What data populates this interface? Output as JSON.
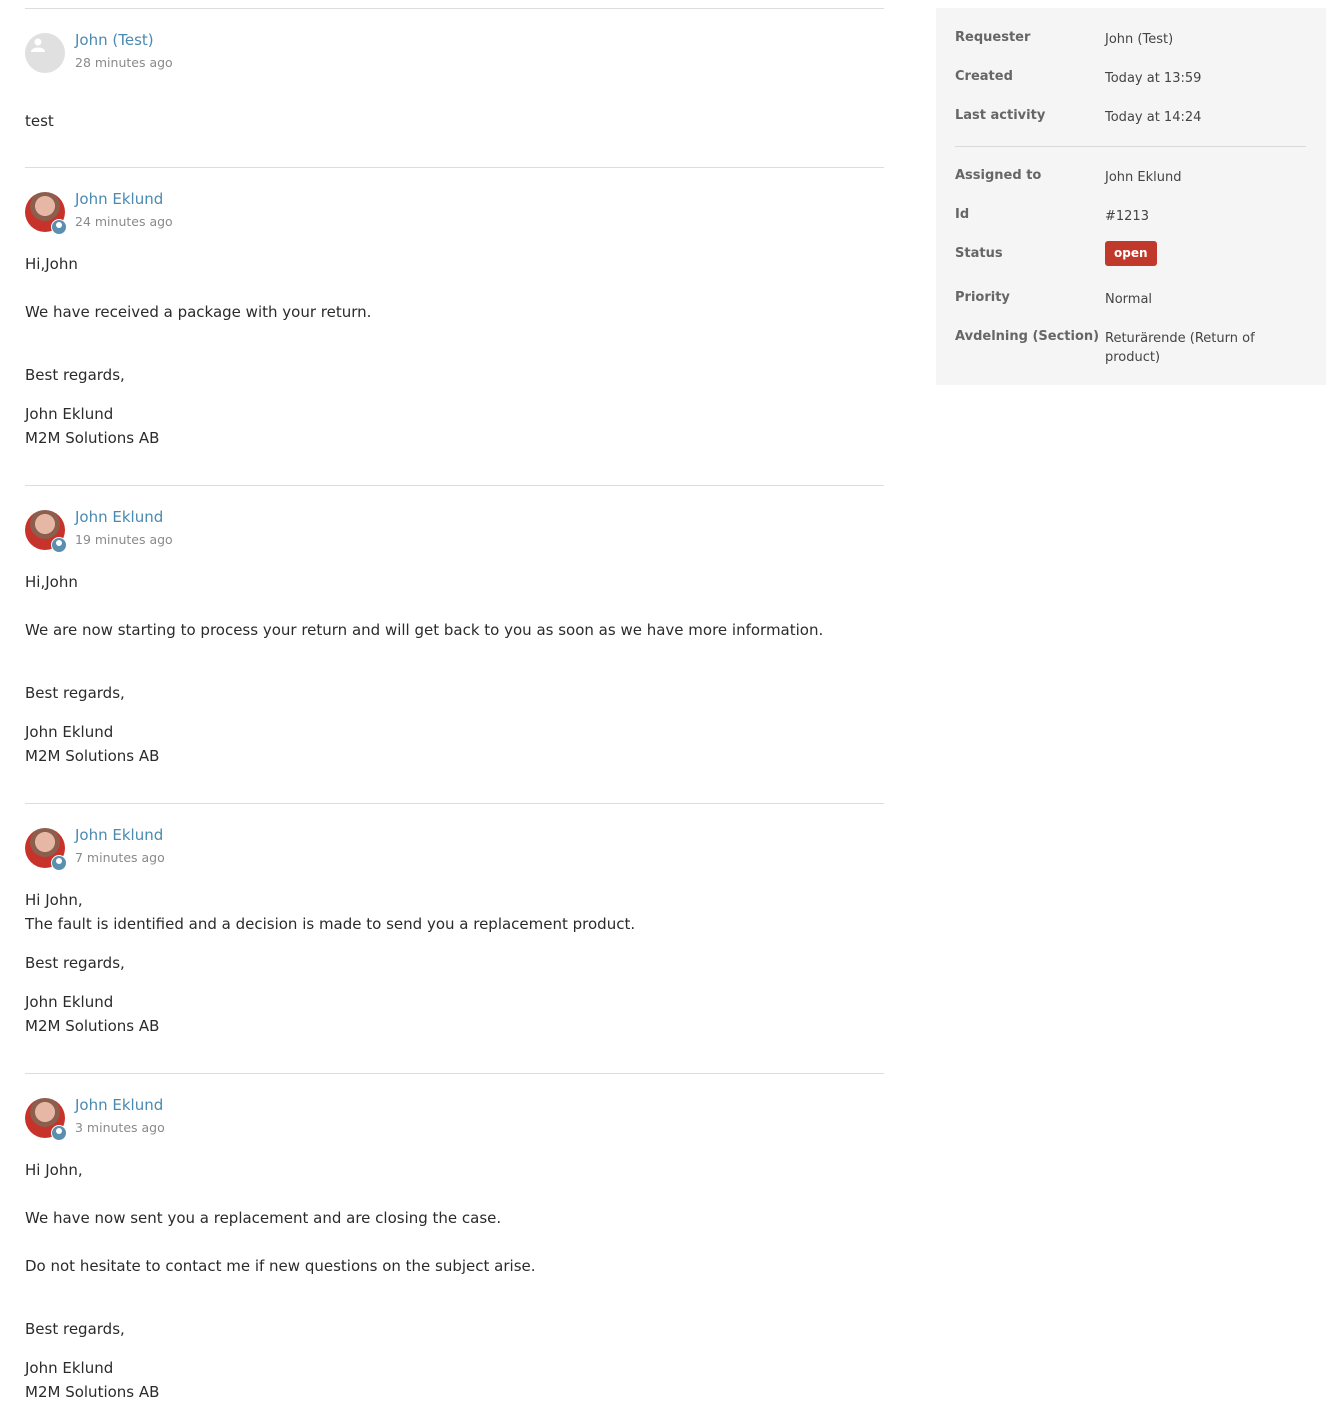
{
  "comments": [
    {
      "author": "John (Test)",
      "time": "28 minutes ago",
      "is_agent": false,
      "lines": [
        "test"
      ]
    },
    {
      "author": "John Eklund",
      "time": "24 minutes ago",
      "is_agent": true,
      "lines": [
        "Hi,John",
        "We have received a package with your return.",
        "Best regards,",
        "John Eklund",
        "M2M Solutions AB"
      ]
    },
    {
      "author": "John Eklund",
      "time": "19 minutes ago",
      "is_agent": true,
      "lines": [
        "Hi,John",
        "We are now starting to process your return and will get back to you as soon as we have more information.",
        "Best regards,",
        "John Eklund",
        "M2M Solutions AB"
      ]
    },
    {
      "author": "John Eklund",
      "time": "7 minutes ago",
      "is_agent": true,
      "lines": [
        "Hi John,",
        "The fault is identified and a decision is made to send you a replacement product.",
        "Best regards,",
        "John Eklund",
        "M2M Solutions AB"
      ]
    },
    {
      "author": "John Eklund",
      "time": "3 minutes ago",
      "is_agent": true,
      "lines": [
        "Hi John,",
        "We have now sent you a replacement and are closing the case.",
        "Do not hesitate to contact me if new questions on the subject arise.",
        "Best regards,",
        "John Eklund",
        "M2M Solutions AB"
      ]
    }
  ],
  "details": {
    "requester_label": "Requester",
    "requester": "John (Test)",
    "created_label": "Created",
    "created": "Today at 13:59",
    "last_activity_label": "Last activity",
    "last_activity": "Today at 14:24",
    "assigned_label": "Assigned to",
    "assigned": "John Eklund",
    "id_label": "Id",
    "id": "#1213",
    "status_label": "Status",
    "status": "open",
    "priority_label": "Priority",
    "priority": "Normal",
    "section_label": "Avdelning (Section)",
    "section": "Returärende (Return of product)"
  },
  "colors": {
    "link": "#4a8ab1",
    "status_open": "#c0392b",
    "sidebar_bg": "#f5f5f5"
  }
}
